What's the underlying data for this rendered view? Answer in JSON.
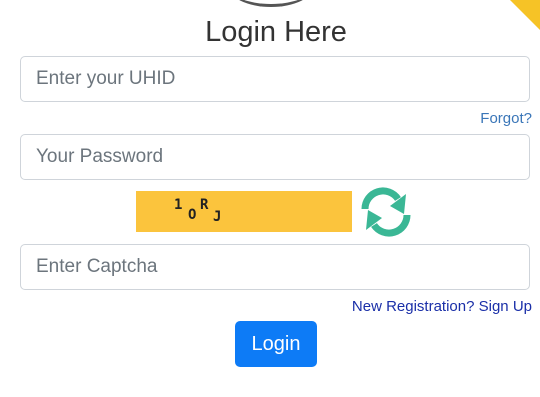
{
  "title": "Login Here",
  "uhid": {
    "placeholder": "Enter your UHID",
    "value": ""
  },
  "forgot_link": "Forgot?",
  "password": {
    "placeholder": "Your Password",
    "value": ""
  },
  "captcha": {
    "chars": [
      "1",
      "O",
      "R",
      "J"
    ]
  },
  "captcha_input": {
    "placeholder": "Enter Captcha",
    "value": ""
  },
  "signup_link": "New Registration? Sign Up",
  "login_button": "Login",
  "colors": {
    "primary": "#0d7bf6",
    "captcha_bg": "#fbc43d",
    "refresh": "#3ab795",
    "link": "#3a76b8",
    "accent": "#f6c326"
  },
  "icons": {
    "refresh": "refresh-icon"
  }
}
